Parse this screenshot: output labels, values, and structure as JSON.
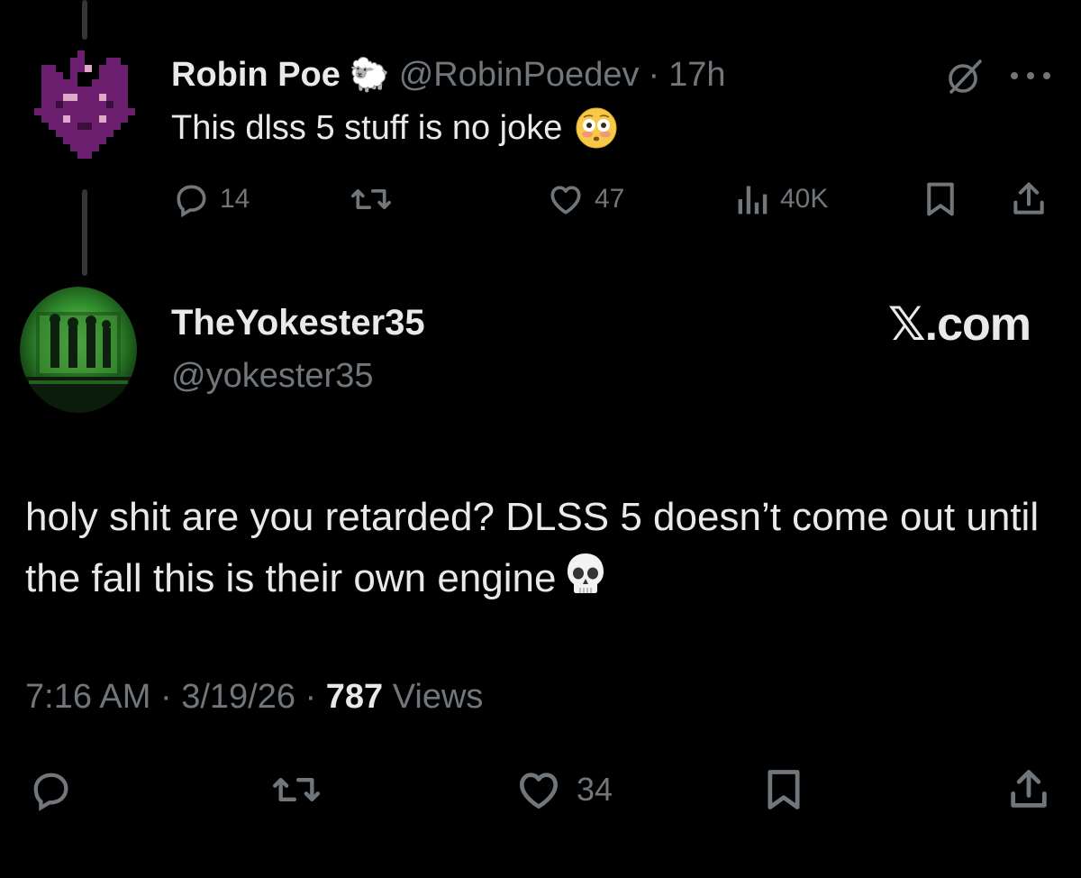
{
  "parent_tweet": {
    "name": "Robin Poe",
    "badge_emoji": "🐑",
    "handle": "@RobinPoedev",
    "separator": "·",
    "time": "17h",
    "text": "This dlss 5 stuff is no joke",
    "actions": {
      "replies": "14",
      "likes": "47",
      "views": "40K"
    }
  },
  "reply_tweet": {
    "name": "TheYokester35",
    "handle": "@yokester35",
    "brand": "𝕏.com",
    "text": "holy shit are you retarded? DLSS 5 doesn’t come out until the fall this is their own engine",
    "meta": {
      "time": "7:16 AM",
      "sep1": " · ",
      "date": "3/19/26",
      "sep2": " · ",
      "views_count": "787",
      "views_label": " Views"
    },
    "actions": {
      "likes": "34"
    }
  },
  "colors": {
    "background": "#000000",
    "primary_text": "#e7e9ea",
    "secondary_text": "#71767b",
    "thread_line": "#333639",
    "avatar_purple": "#6b1f6e",
    "avatar_green": "#3fae3a"
  },
  "icons": [
    "reply-icon",
    "retweet-icon",
    "like-icon",
    "views-icon",
    "bookmark-icon",
    "share-icon",
    "grok-icon",
    "more-icon",
    "sheep-emoji",
    "flushed-emoji",
    "skull-emoji"
  ]
}
